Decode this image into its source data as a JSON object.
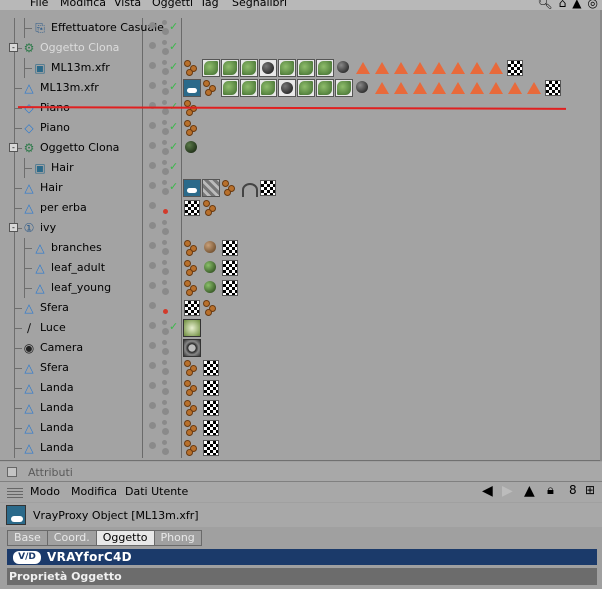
{
  "menu": {
    "items": [
      "File",
      "Modifica",
      "Vista",
      "Oggetti",
      "Tag",
      "Segnalibri"
    ]
  },
  "objects": [
    {
      "name": "Effettuatore Casuale",
      "icon": "effector-icon",
      "indent": 1,
      "grey": false,
      "check": true,
      "tags": []
    },
    {
      "name": "Oggetto Clona",
      "icon": "cloner-icon",
      "indent": 0,
      "expander": "-",
      "grey": true,
      "check": true,
      "tags": []
    },
    {
      "name": "ML13m.xfr",
      "icon": "vrayproxy-icon",
      "indent": 1,
      "grey": false,
      "check": true,
      "tags": [
        "balls",
        "leafmat",
        "leafmat",
        "leafmat",
        "blackmat",
        "leafmat",
        "leafmat",
        "leafmat",
        "blackball",
        "tri",
        "tri",
        "tri",
        "tri",
        "tri",
        "tri",
        "tri",
        "tri",
        "chk"
      ]
    },
    {
      "name": "ML13m.xfr",
      "icon": "polygon-icon",
      "indent": 0,
      "grey": false,
      "check": true,
      "tags": [
        "hair",
        "balls",
        "leafmat",
        "leafmat",
        "leafmat",
        "blackmat",
        "leafmat",
        "leafmat",
        "leafmat",
        "blackball",
        "tri",
        "tri",
        "tri",
        "tri",
        "tri",
        "tri",
        "tri",
        "tri",
        "tri",
        "chk"
      ]
    },
    {
      "name": "Piano",
      "icon": "plane-icon",
      "indent": 0,
      "grey": false,
      "check": true,
      "tags": [
        "balls"
      ]
    },
    {
      "name": "Piano",
      "icon": "plane-icon",
      "indent": 0,
      "grey": false,
      "check": true,
      "tags": [
        "balls"
      ]
    },
    {
      "name": "Oggetto Clona",
      "icon": "cloner-icon",
      "indent": 0,
      "expander": "-",
      "grey": false,
      "check": true,
      "tags": [
        "darkball"
      ]
    },
    {
      "name": "Hair",
      "icon": "vrayproxy-icon",
      "indent": 1,
      "grey": false,
      "check": true,
      "tags": []
    },
    {
      "name": "Hair",
      "icon": "polygon-icon",
      "indent": 0,
      "grey": false,
      "check": true,
      "tags": [
        "hair",
        "stripe",
        "balls",
        "arc",
        "chk"
      ]
    },
    {
      "name": "per erba",
      "icon": "polygon-icon",
      "indent": 0,
      "grey": false,
      "check": false,
      "red": true,
      "tags": [
        "chk",
        "balls"
      ]
    },
    {
      "name": "ivy",
      "icon": "null-icon",
      "indent": 0,
      "expander": "-",
      "grey": false,
      "check": false,
      "tags": []
    },
    {
      "name": "branches",
      "icon": "polygon-icon",
      "indent": 1,
      "grey": false,
      "check": false,
      "tags": [
        "balls",
        "brownball",
        "chk"
      ]
    },
    {
      "name": "leaf_adult",
      "icon": "polygon-icon",
      "indent": 1,
      "grey": false,
      "check": false,
      "tags": [
        "balls",
        "greenball",
        "chk"
      ]
    },
    {
      "name": "leaf_young",
      "icon": "polygon-icon",
      "indent": 1,
      "grey": false,
      "check": false,
      "tags": [
        "balls",
        "greenball",
        "chk"
      ]
    },
    {
      "name": "Sfera",
      "icon": "polygon-icon",
      "indent": 0,
      "grey": false,
      "check": false,
      "red": true,
      "tags": [
        "chk",
        "balls"
      ]
    },
    {
      "name": "Luce",
      "icon": "light-icon",
      "indent": 0,
      "grey": false,
      "check": true,
      "tags": [
        "lighttag"
      ]
    },
    {
      "name": "Camera",
      "icon": "camera-icon",
      "indent": 0,
      "grey": false,
      "check": false,
      "tags": [
        "cameratag"
      ]
    },
    {
      "name": "Sfera",
      "icon": "polygon-icon",
      "indent": 0,
      "grey": false,
      "check": false,
      "tags": [
        "balls",
        "chk"
      ]
    },
    {
      "name": "Landa",
      "icon": "polygon-icon",
      "indent": 0,
      "grey": false,
      "check": false,
      "tags": [
        "balls",
        "chk"
      ]
    },
    {
      "name": "Landa",
      "icon": "polygon-icon",
      "indent": 0,
      "grey": false,
      "check": false,
      "tags": [
        "balls",
        "chk"
      ]
    },
    {
      "name": "Landa",
      "icon": "polygon-icon",
      "indent": 0,
      "grey": false,
      "check": false,
      "tags": [
        "balls",
        "chk"
      ]
    },
    {
      "name": "Landa",
      "icon": "polygon-icon",
      "indent": 0,
      "grey": false,
      "check": false,
      "tags": [
        "balls",
        "chk"
      ]
    }
  ],
  "attributes": {
    "header": "Attributi",
    "menu": [
      "Modo",
      "Modifica",
      "Dati Utente"
    ],
    "object_title": "VrayProxy Object [ML13m.xfr]",
    "tabs": [
      {
        "label": "Base",
        "active": false
      },
      {
        "label": "Coord.",
        "active": false
      },
      {
        "label": "Oggetto",
        "active": true
      },
      {
        "label": "Phong",
        "active": false
      }
    ],
    "vray_logo_mark": "V/D",
    "vray_logo_word": "VRAYforC4D",
    "section": "Proprietà Oggetto"
  }
}
